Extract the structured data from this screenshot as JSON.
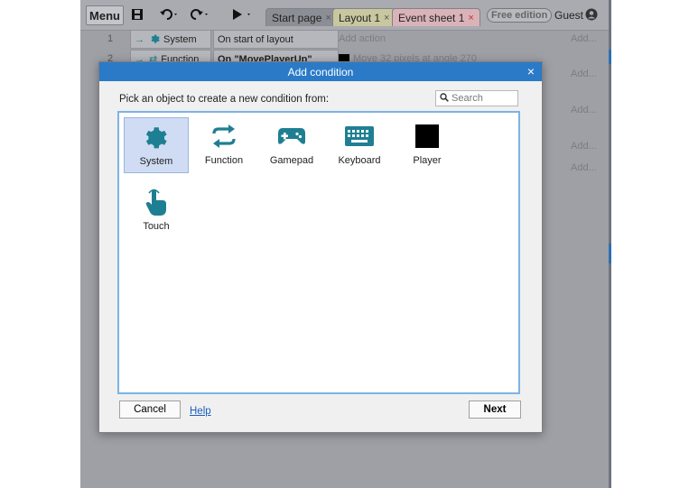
{
  "toolbar": {
    "menu_label": "Menu",
    "tabs": [
      {
        "label": "Start page",
        "close": "×"
      },
      {
        "label": "Layout 1",
        "close": "×"
      },
      {
        "label": "Event sheet 1",
        "close": "×"
      }
    ],
    "edition_badge": "Free edition",
    "user_label": "Guest"
  },
  "event_sheet": {
    "rows": [
      {
        "number": "1",
        "object": "System",
        "condition": "On start of layout",
        "action": "Add action",
        "add": "Add..."
      },
      {
        "number": "2",
        "object": "Function",
        "condition": "On \"MovePlayerUp\"",
        "action": "Move 32 pixels at angle 270",
        "add": ""
      }
    ],
    "side_add_labels": [
      "Add...",
      "Add...",
      "Add...",
      "Add..."
    ]
  },
  "dialog": {
    "title": "Add condition",
    "close": "×",
    "prompt": "Pick an object to create a new condition from:",
    "search_placeholder": "Search",
    "objects": [
      {
        "label": "System",
        "icon": "gear-icon"
      },
      {
        "label": "Function",
        "icon": "repeat-arrows-icon"
      },
      {
        "label": "Gamepad",
        "icon": "gamepad-icon"
      },
      {
        "label": "Keyboard",
        "icon": "keyboard-icon"
      },
      {
        "label": "Player",
        "icon": "black-square-sprite-icon"
      },
      {
        "label": "Touch",
        "icon": "touch-hand-icon"
      }
    ],
    "cancel_label": "Cancel",
    "help_label": "Help",
    "next_label": "Next"
  },
  "colors": {
    "accent": "#2a7ac8",
    "icon_teal": "#1f7f92",
    "selected_tile": "#cfdcf3"
  }
}
